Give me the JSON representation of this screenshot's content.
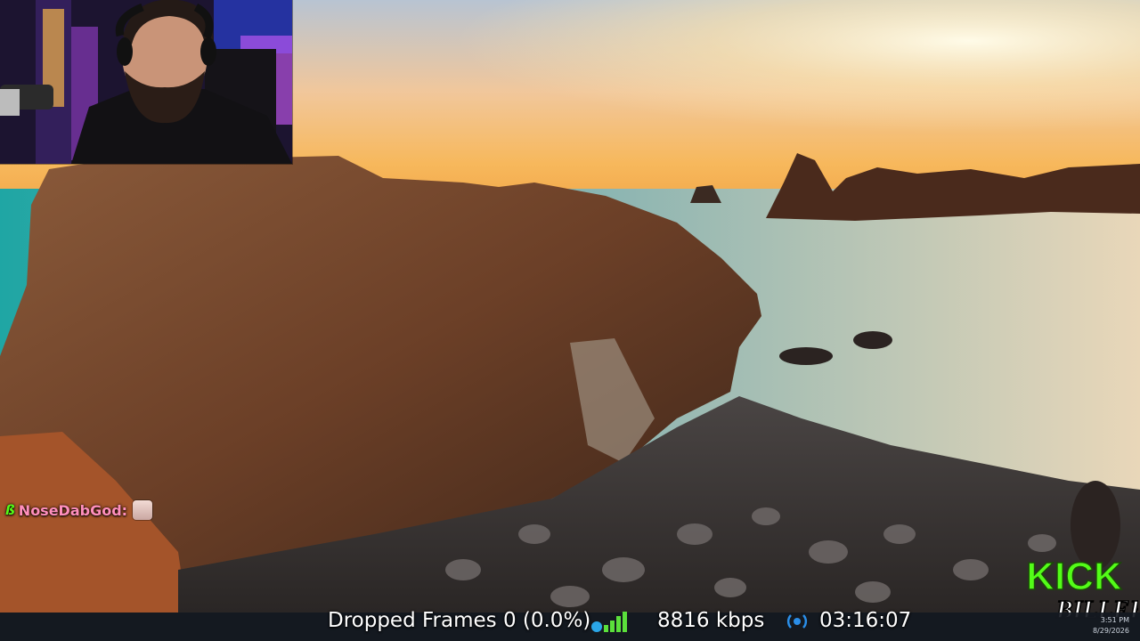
{
  "stream": {
    "dropped_frames": "Dropped Frames 0 (0.0%)",
    "bitrate": "8816 kbps",
    "uptime": "03:16:07"
  },
  "chat": {
    "username": "NoseDabGod:",
    "badge": "ß"
  },
  "logo": {
    "kick": "KICK",
    "channel": "BILLEH"
  },
  "tray": {
    "time": "3:51 PM",
    "date": "8/29/2026"
  },
  "colors": {
    "kick_green": "#53fc18",
    "username_pink": "#ff8fbd"
  },
  "icons": {
    "signal": "signal-bars-icon",
    "wifi": "wifi-icon",
    "stream_status": "broadcast-icon"
  }
}
